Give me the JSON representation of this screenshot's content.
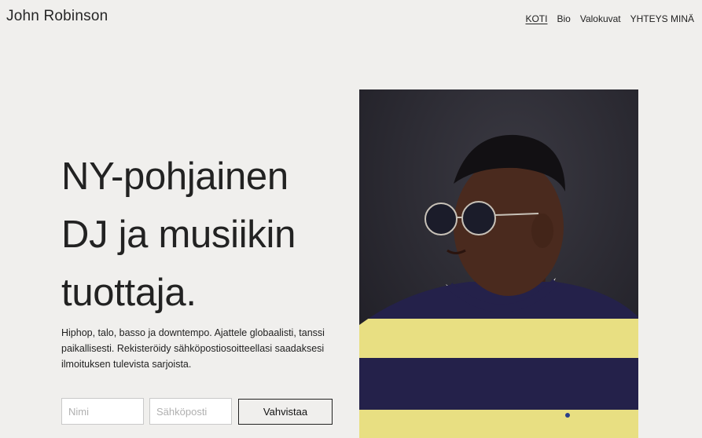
{
  "header": {
    "site_title": "John Robinson",
    "nav": [
      {
        "label": "KOTI",
        "active": true
      },
      {
        "label": "Bio",
        "active": false
      },
      {
        "label": "Valokuvat",
        "active": false
      },
      {
        "label": "YHTEYS MINÄ",
        "active": false
      }
    ]
  },
  "hero": {
    "heading_lines": [
      "NY-pohjainen",
      "DJ ja musiikin",
      "tuottaja."
    ],
    "description": "Hiphop, talo, basso ja downtempo. Ajattele globaalisti, tanssi paikallisesti. Rekisteröidy sähköpostiosoitteellasi saadaksesi ilmoituksen tulevista sarjoista."
  },
  "signup_form": {
    "name_placeholder": "Nimi",
    "email_placeholder": "Sähköposti",
    "submit_label": "Vahvistaa"
  },
  "colors": {
    "background": "#f0efed",
    "text": "#222222",
    "sweater_navy": "#24214a",
    "sweater_yellow": "#e8df82"
  }
}
